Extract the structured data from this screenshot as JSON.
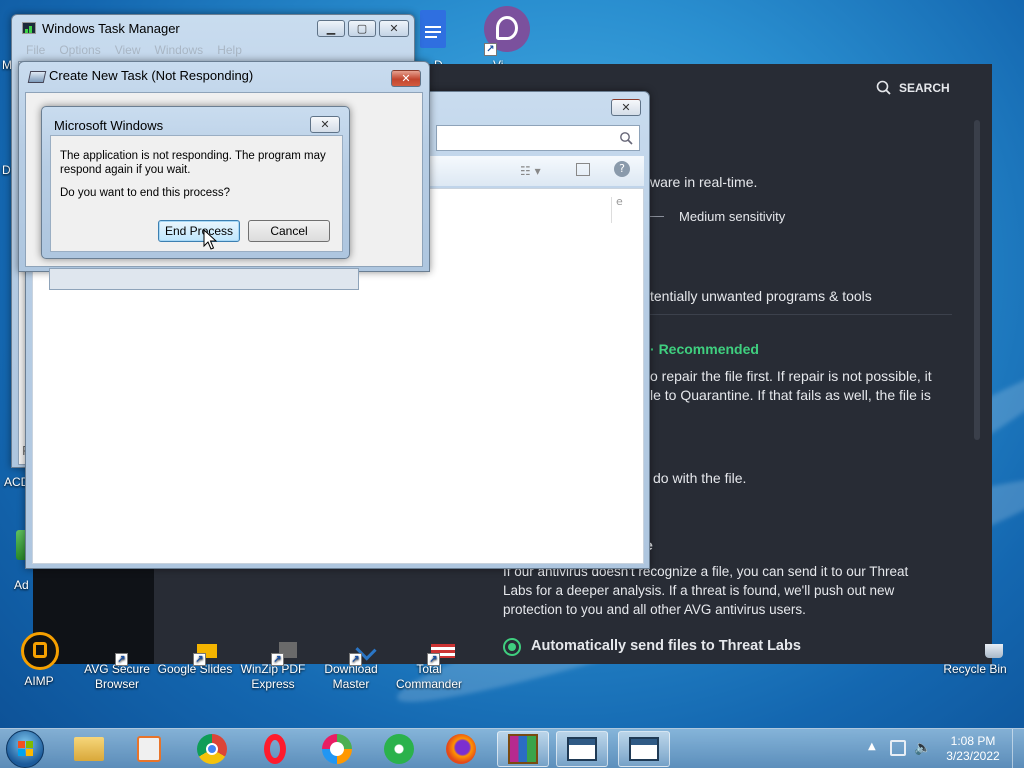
{
  "desktop": {
    "icons_bottom": [
      {
        "label": "AIMP"
      },
      {
        "label": "AVG Secure Browser"
      },
      {
        "label": "Google Slides"
      },
      {
        "label": "WinZip PDF Express"
      },
      {
        "label": "Download Master"
      },
      {
        "label": "Total Commander"
      }
    ],
    "recycle_bin": "Recycle Bin",
    "top_icon_label": "Vi",
    "partial_labels": {
      "left_m": "M",
      "left_d": "D",
      "left_acd": "ACD",
      "left_ad": "Ad",
      "top_d": "D"
    }
  },
  "avg": {
    "search_label": "SEARCH",
    "text_realtime": "ware in real-time.",
    "sensitivity": "Medium sensitivity",
    "pup_text": "tentially unwanted programs & tools",
    "recommended": "Recommended",
    "repair_line1": "o repair the file first. If repair is not possible, it",
    "repair_line2": "le to Quarantine. If that fails as well, the file is",
    "do_with": "do with the file.",
    "heading_e": "e",
    "threat_line1": "If our antivirus doesn't recognize a file, you can send it to our Threat",
    "threat_line2": "Labs for a deeper analysis. If a threat is found, we'll push out new",
    "threat_line3": "protection to you and all other AVG antivirus users.",
    "auto_send": "Automatically send files to Threat Labs",
    "accent": "#3fcf7f"
  },
  "task_manager": {
    "title": "Windows Task Manager",
    "menu": [
      "File",
      "Options",
      "View",
      "Windows",
      "Help"
    ],
    "partial_p": "P"
  },
  "create_task": {
    "title": "Create New Task (Not Responding)"
  },
  "dialog": {
    "title": "Microsoft Windows",
    "message_line1": "The application is not responding. The program may",
    "message_line2": "respond again if you wait.",
    "question": "Do you want to end this process?",
    "end_process": "End Process",
    "cancel": "Cancel"
  },
  "explorer": {
    "partial_e": "e"
  },
  "taskbar": {
    "apps": [
      "explorer-icon",
      "media-player-icon",
      "chrome-icon",
      "opera-icon",
      "avg-browser-icon",
      "icq-icon",
      "firefox-icon",
      "winrar-icon",
      "task-window-1-icon",
      "task-window-2-icon"
    ],
    "time": "1:08 PM",
    "date": "3/23/2022"
  }
}
